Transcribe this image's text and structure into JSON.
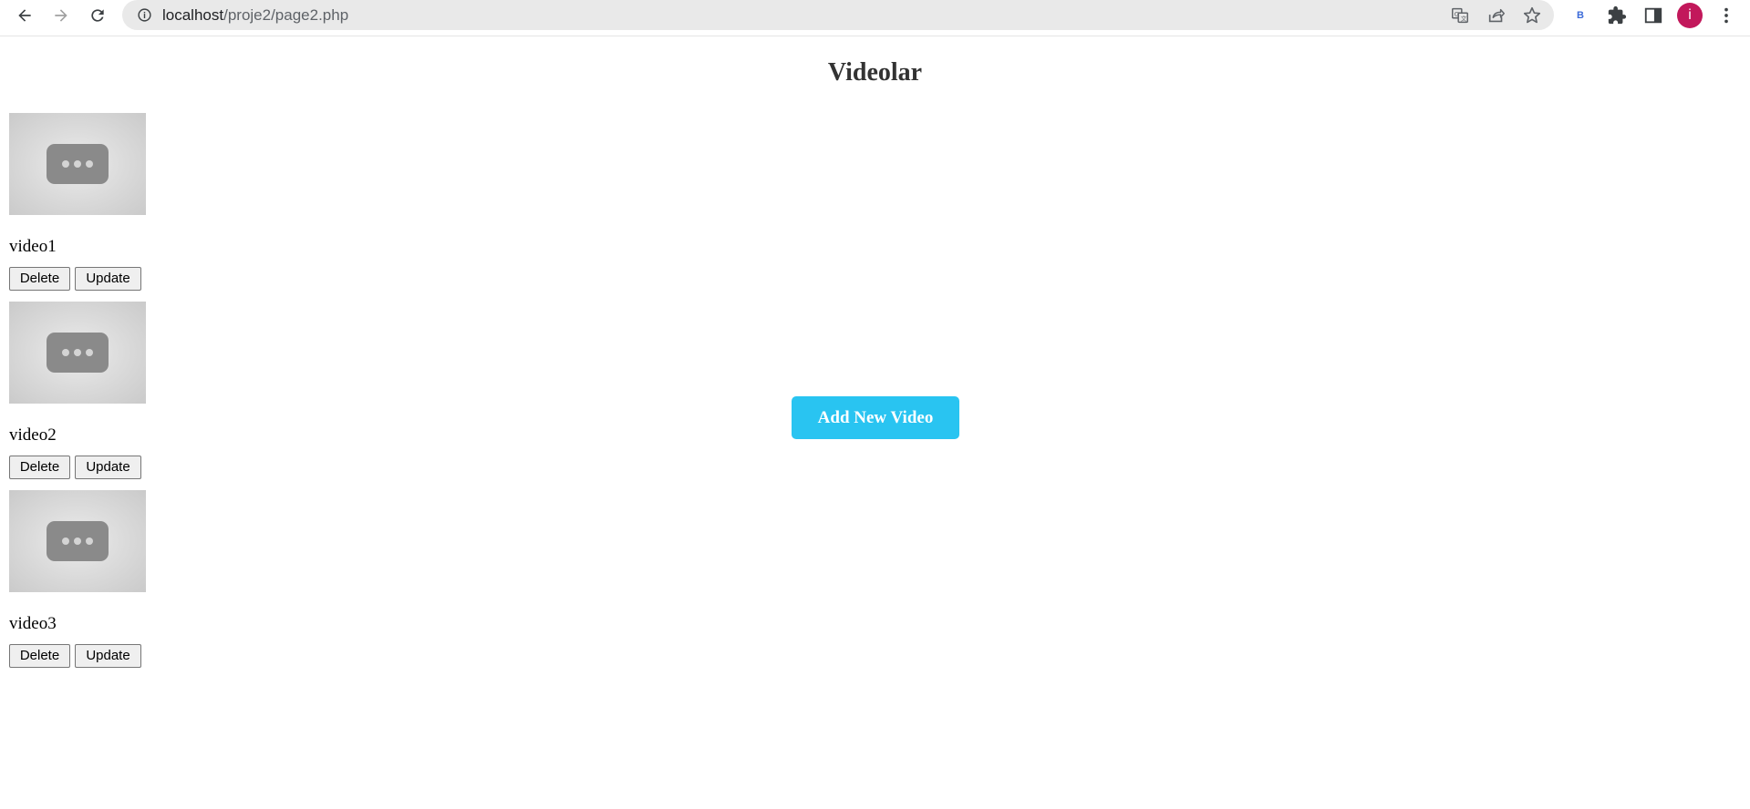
{
  "browser": {
    "url_host": "localhost",
    "url_path": "/proje2/page2.php",
    "extension_label": "B",
    "profile_initial": "i"
  },
  "page": {
    "title": "Videolar",
    "add_button_label": "Add New Video",
    "accent_color": "#29c4f1"
  },
  "videos": [
    {
      "name": "video1",
      "delete_label": "Delete",
      "update_label": "Update"
    },
    {
      "name": "video2",
      "delete_label": "Delete",
      "update_label": "Update"
    },
    {
      "name": "video3",
      "delete_label": "Delete",
      "update_label": "Update"
    }
  ]
}
